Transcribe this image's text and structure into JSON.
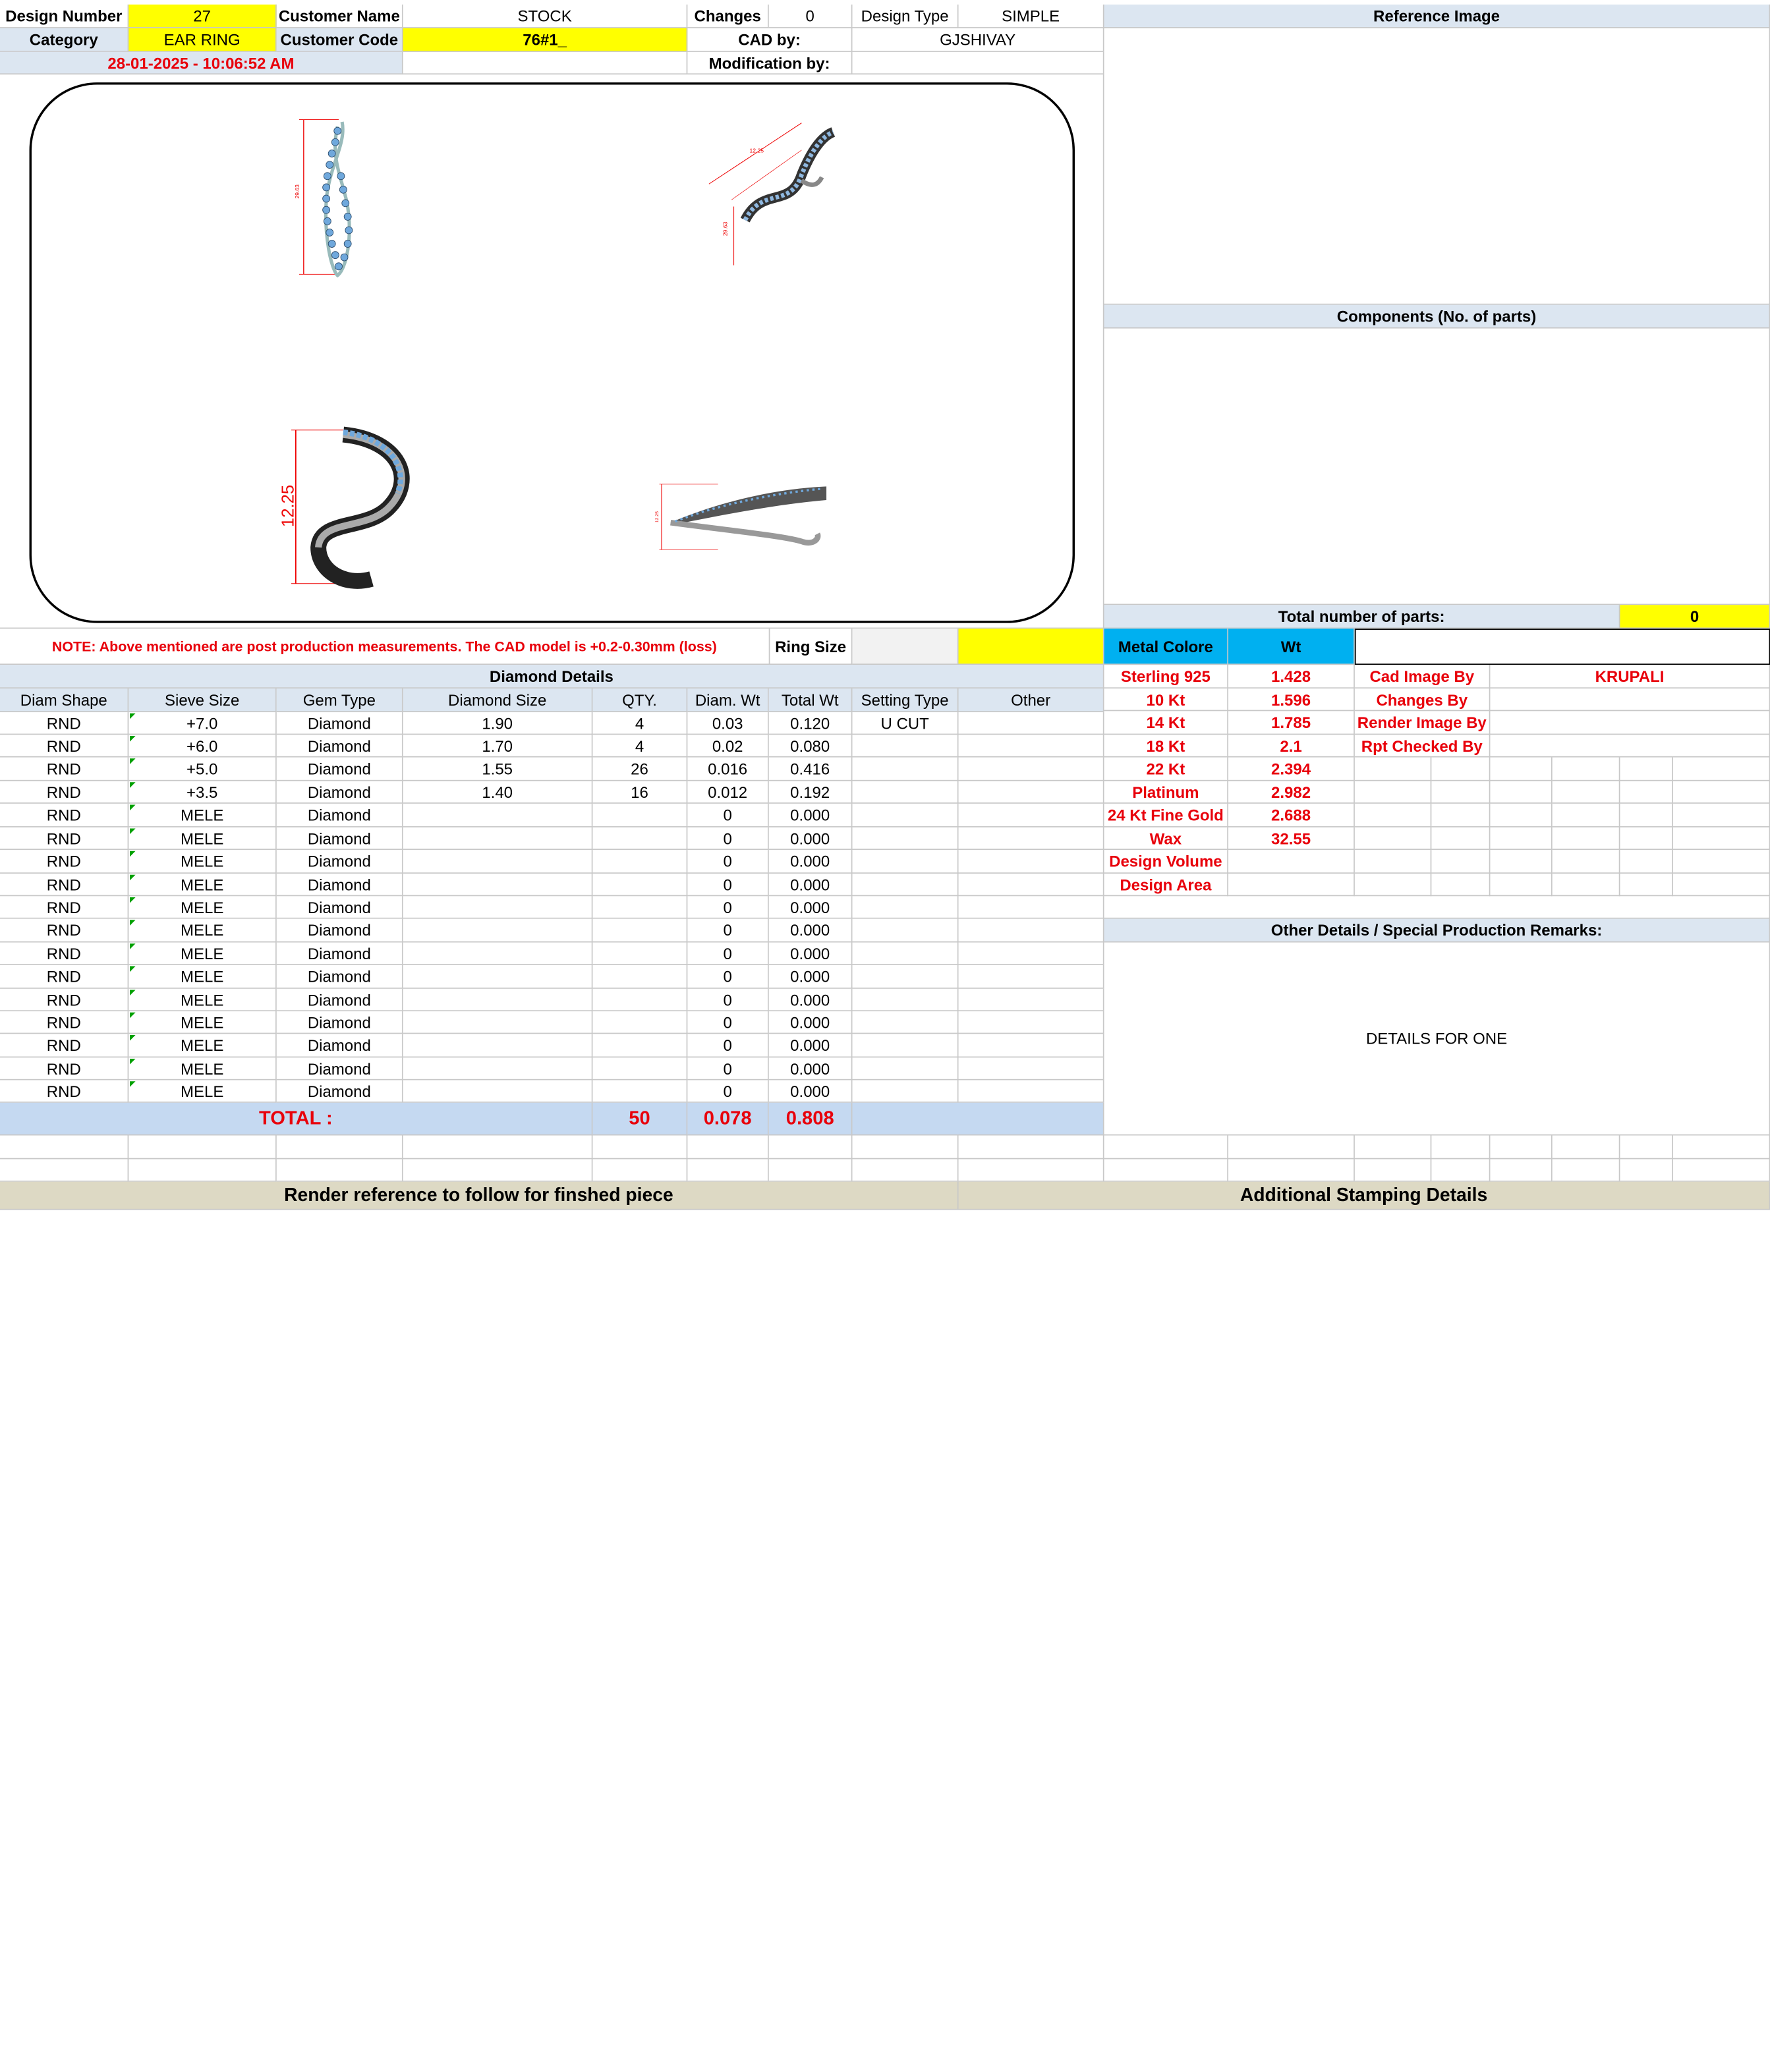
{
  "header": {
    "design_number_label": "Design Number",
    "design_number": "27",
    "customer_name_label": "Customer Name",
    "customer_name": "STOCK",
    "changes_label": "Changes",
    "changes": "0",
    "design_type_label": "Design Type",
    "design_type": "SIMPLE",
    "reference_image_label": "Reference Image",
    "category_label": "Category",
    "category": "EAR RING",
    "customer_code_label": "Customer Code",
    "customer_code": "76#1_",
    "cad_by_label": "CAD by:",
    "cad_by": "GJSHIVAY",
    "timestamp": "28-01-2025 - 10:06:52 AM",
    "modification_by_label": "Modification by:"
  },
  "render": {
    "dim_front": "29.63",
    "dim_side": "12.25",
    "dim_top": "12.25",
    "dim_persp_a": "12.25",
    "dim_persp_b": "29.63"
  },
  "components": {
    "label": "Components (No. of parts)",
    "total_parts_label": "Total number of parts:",
    "total_parts": "0"
  },
  "note": {
    "text": "NOTE: Above mentioned are post production measurements. The CAD model is +0.2-0.30mm (loss)",
    "ring_size_label": "Ring Size"
  },
  "metal": {
    "header_label": "Metal Colore",
    "wt_label": "Wt",
    "rows": [
      {
        "name": "Sterling 925",
        "wt": "1.428"
      },
      {
        "name": "10 Kt",
        "wt": "1.596"
      },
      {
        "name": "14 Kt",
        "wt": "1.785"
      },
      {
        "name": "18 Kt",
        "wt": "2.1"
      },
      {
        "name": "22 Kt",
        "wt": "2.394"
      },
      {
        "name": "Platinum",
        "wt": "2.982"
      },
      {
        "name": "24 Kt Fine Gold",
        "wt": "2.688"
      },
      {
        "name": "Wax",
        "wt": "32.55"
      },
      {
        "name": "Design Volume",
        "wt": ""
      },
      {
        "name": "Design Area",
        "wt": ""
      }
    ]
  },
  "credits": {
    "cad_image_by_label": "Cad Image By",
    "cad_image_by": "KRUPALI",
    "changes_by_label": "Changes By",
    "render_image_by_label": "Render Image By",
    "rpt_checked_by_label": "Rpt Checked By"
  },
  "remarks": {
    "label": "Other Details / Special Production Remarks:",
    "text": "DETAILS FOR ONE"
  },
  "diamond": {
    "title": "Diamond Details",
    "columns": [
      "Diam Shape",
      "Sieve Size",
      "Gem Type",
      "Diamond Size",
      "QTY.",
      "Diam. Wt",
      "Total Wt",
      "Setting Type",
      "Other"
    ],
    "rows": [
      [
        "RND",
        "+7.0",
        "Diamond",
        "1.90",
        "4",
        "0.03",
        "0.120",
        "U CUT",
        ""
      ],
      [
        "RND",
        "+6.0",
        "Diamond",
        "1.70",
        "4",
        "0.02",
        "0.080",
        "",
        ""
      ],
      [
        "RND",
        "+5.0",
        "Diamond",
        "1.55",
        "26",
        "0.016",
        "0.416",
        "",
        ""
      ],
      [
        "RND",
        "+3.5",
        "Diamond",
        "1.40",
        "16",
        "0.012",
        "0.192",
        "",
        ""
      ],
      [
        "RND",
        "MELE",
        "Diamond",
        "",
        "",
        "0",
        "0.000",
        "",
        ""
      ],
      [
        "RND",
        "MELE",
        "Diamond",
        "",
        "",
        "0",
        "0.000",
        "",
        ""
      ],
      [
        "RND",
        "MELE",
        "Diamond",
        "",
        "",
        "0",
        "0.000",
        "",
        ""
      ],
      [
        "RND",
        "MELE",
        "Diamond",
        "",
        "",
        "0",
        "0.000",
        "",
        ""
      ],
      [
        "RND",
        "MELE",
        "Diamond",
        "",
        "",
        "0",
        "0.000",
        "",
        ""
      ],
      [
        "RND",
        "MELE",
        "Diamond",
        "",
        "",
        "0",
        "0.000",
        "",
        ""
      ],
      [
        "RND",
        "MELE",
        "Diamond",
        "",
        "",
        "0",
        "0.000",
        "",
        ""
      ],
      [
        "RND",
        "MELE",
        "Diamond",
        "",
        "",
        "0",
        "0.000",
        "",
        ""
      ],
      [
        "RND",
        "MELE",
        "Diamond",
        "",
        "",
        "0",
        "0.000",
        "",
        ""
      ],
      [
        "RND",
        "MELE",
        "Diamond",
        "",
        "",
        "0",
        "0.000",
        "",
        ""
      ],
      [
        "RND",
        "MELE",
        "Diamond",
        "",
        "",
        "0",
        "0.000",
        "",
        ""
      ],
      [
        "RND",
        "MELE",
        "Diamond",
        "",
        "",
        "0",
        "0.000",
        "",
        ""
      ],
      [
        "RND",
        "MELE",
        "Diamond",
        "",
        "",
        "0",
        "0.000",
        "",
        ""
      ]
    ],
    "total_label": "TOTAL :",
    "total_qty": "50",
    "total_diam_wt": "0.078",
    "total_wt": "0.808"
  },
  "footer": {
    "render_reference": "Render reference to follow for finshed piece",
    "stamping": "Additional Stamping Details"
  }
}
